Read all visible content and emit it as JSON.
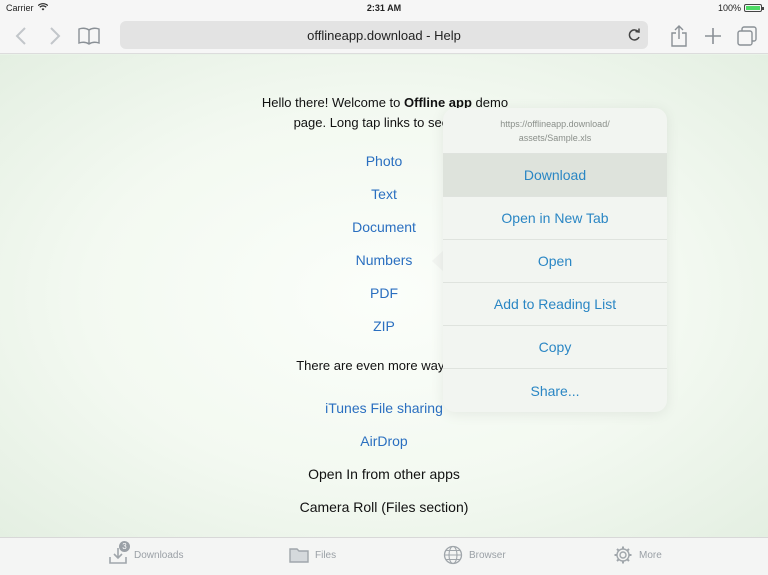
{
  "status_bar": {
    "carrier": "Carrier",
    "time": "2:31 AM",
    "battery": "100%",
    "battery_level": 1.0
  },
  "toolbar": {
    "url": "offlineapp.download - Help",
    "icons": [
      "back-icon",
      "forward-icon",
      "bookmarks-icon",
      "reload-icon",
      "share-icon",
      "add-tab-icon",
      "tabs-icon"
    ]
  },
  "content": {
    "intro_prefix": "Hello there! Welcome to",
    "intro_brand": "Offline app",
    "intro_demo": "demo",
    "intro_line2": "page. Long tap links to see dow",
    "links": [
      "Photo",
      "Text",
      "Document",
      "Numbers",
      "PDF",
      "ZIP"
    ],
    "more_ways": "There are even more ways to i",
    "more_links": [
      "iTunes File sharing",
      "AirDrop"
    ],
    "plain_items": [
      "Open In from other apps",
      "Camera Roll (Files section)"
    ]
  },
  "popover": {
    "url_line1": "https://offlineapp.download/",
    "url_line2": "assets/Sample.xls",
    "items": [
      "Download",
      "Open in New Tab",
      "Open",
      "Add to Reading List",
      "Copy",
      "Share..."
    ],
    "highlighted": "Download"
  },
  "tabbar": {
    "downloads_label": "Downloads",
    "downloads_badge": "3",
    "files_label": "Files",
    "browser_label": "Browser",
    "more_label": "More"
  },
  "colors": {
    "link": "#2a6fc0",
    "popover_text": "#2a86c4",
    "background": "#e9f3e8"
  }
}
